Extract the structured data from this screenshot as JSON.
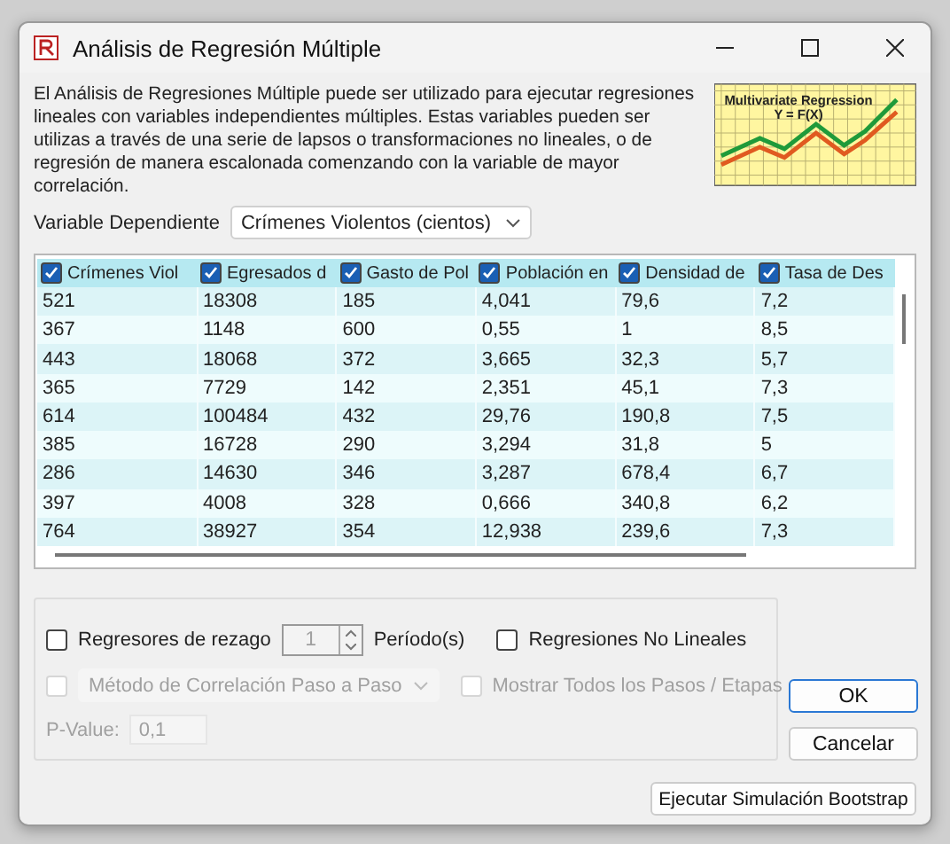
{
  "window": {
    "title": "Análisis de Regresión Múltiple"
  },
  "description": "El Análisis de Regresiones Múltiple puede ser utilizado para ejecutar regresiones lineales con variables independientes múltiples. Estas variables pueden ser utilizas a través de una serie de lapsos o transformaciones no lineales, o de regresión de manera escalonada comenzando con la variable de mayor correlación.",
  "banner": {
    "title": "Multivariate Regression",
    "formula": "Y = F(X)"
  },
  "dependent_variable": {
    "label": "Variable Dependiente",
    "value": "Crímenes Violentos (cientos)"
  },
  "table": {
    "columns": [
      {
        "label": "Crímenes Viol",
        "checked": true
      },
      {
        "label": "Egresados d",
        "checked": true
      },
      {
        "label": "Gasto de Pol",
        "checked": true
      },
      {
        "label": "Población en",
        "checked": true
      },
      {
        "label": "Densidad de",
        "checked": true
      },
      {
        "label": "Tasa de Des",
        "checked": true
      }
    ],
    "rows": [
      [
        "521",
        "18308",
        "185",
        "4,041",
        "79,6",
        "7,2"
      ],
      [
        "367",
        "1148",
        "600",
        "0,55",
        "1",
        "8,5"
      ],
      [
        "443",
        "18068",
        "372",
        "3,665",
        "32,3",
        "5,7"
      ],
      [
        "365",
        "7729",
        "142",
        "2,351",
        "45,1",
        "7,3"
      ],
      [
        "614",
        "100484",
        "432",
        "29,76",
        "190,8",
        "7,5"
      ],
      [
        "385",
        "16728",
        "290",
        "3,294",
        "31,8",
        "5"
      ],
      [
        "286",
        "14630",
        "346",
        "3,287",
        "678,4",
        "6,7"
      ],
      [
        "397",
        "4008",
        "328",
        "0,666",
        "340,8",
        "6,2"
      ],
      [
        "764",
        "38927",
        "354",
        "12,938",
        "239,6",
        "7,3"
      ]
    ]
  },
  "options": {
    "lag": {
      "label": "Regresores de rezago",
      "checked": false,
      "value": "1",
      "unit": "Período(s)",
      "disabled": true
    },
    "nonlinear": {
      "label": "Regresiones No Lineales",
      "checked": false
    },
    "method": {
      "checked": false,
      "disabled": true,
      "label": "Método de Correlación",
      "value": "Paso a Paso"
    },
    "show_steps": {
      "label": "Mostrar Todos los Pasos / Etapas",
      "checked": false,
      "disabled": true
    },
    "p_value": {
      "label": "P-Value:",
      "value": "0,1",
      "disabled": true
    }
  },
  "buttons": {
    "ok": "OK",
    "cancel": "Cancelar",
    "bootstrap": "Ejecutar Simulación Bootstrap"
  }
}
